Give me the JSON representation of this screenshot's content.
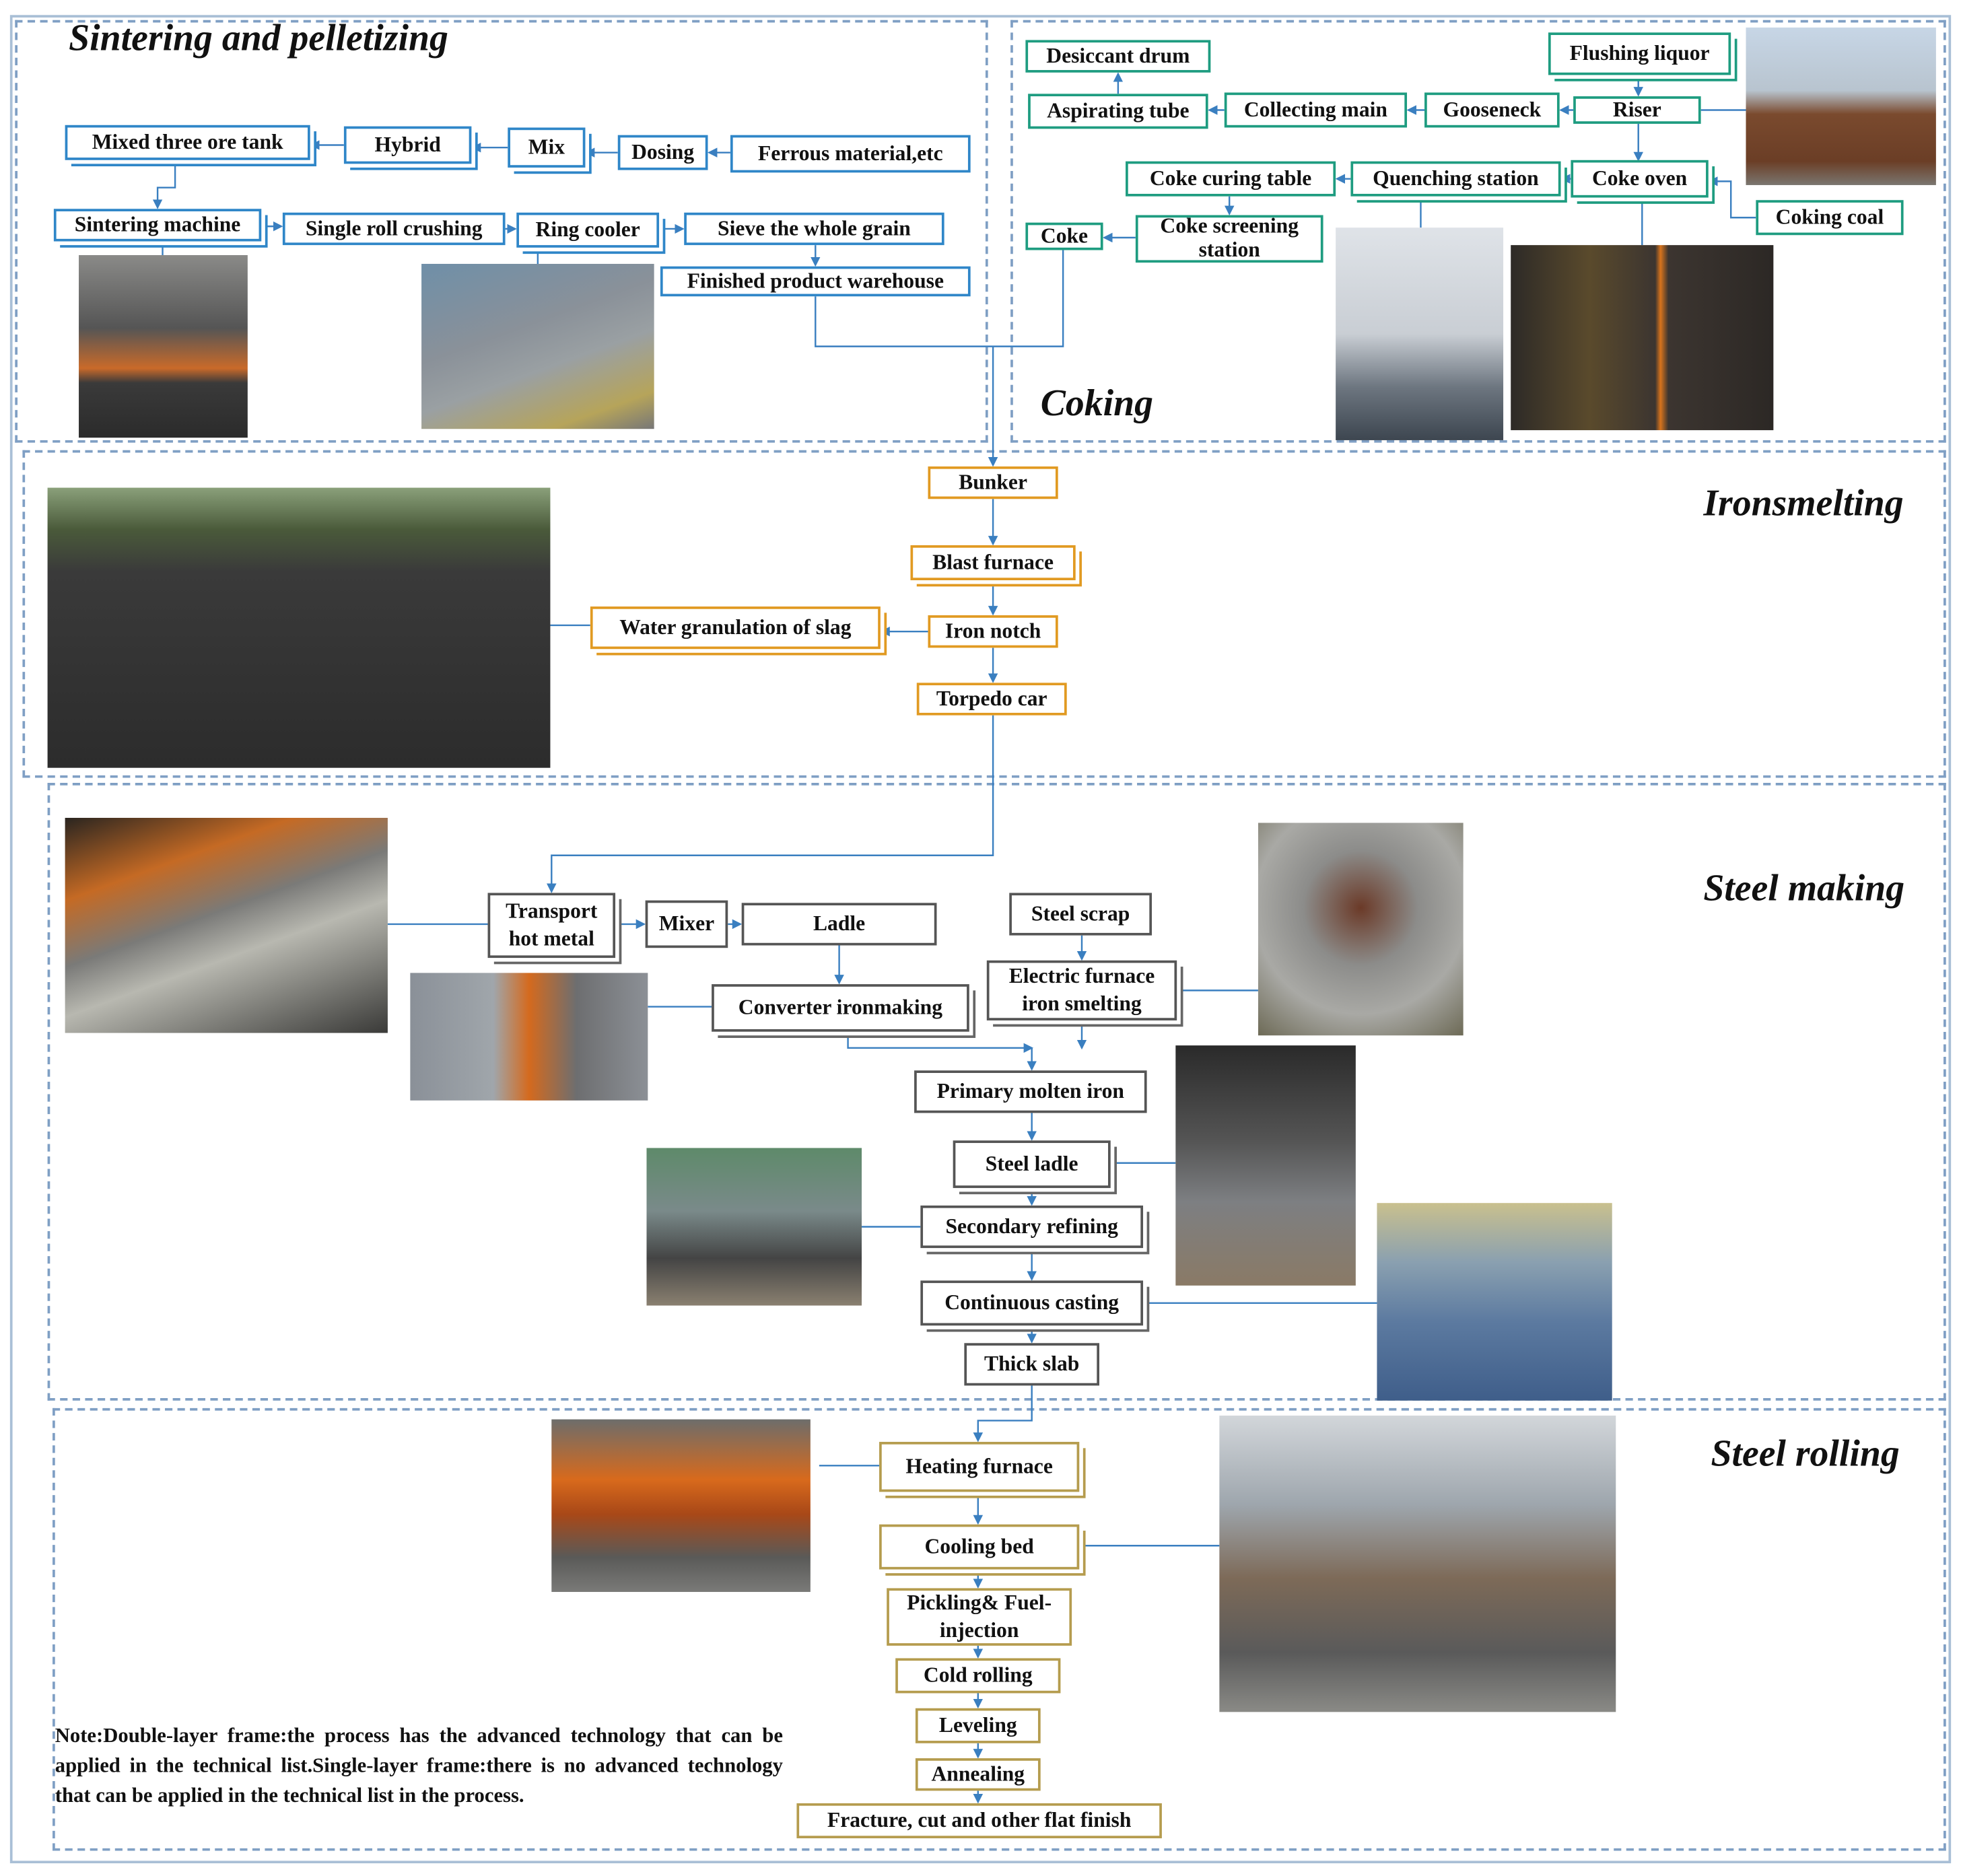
{
  "sections": {
    "sintering": "Sintering and pelletizing",
    "coking": "Coking",
    "ironsmelting": "Ironsmelting",
    "steelmaking": "Steel making",
    "steelrolling": "Steel rolling"
  },
  "nodes": {
    "mixed_tank": "Mixed three ore tank",
    "hybrid": "Hybrid",
    "mix": "Mix",
    "dosing": "Dosing",
    "ferrous": "Ferrous material,etc",
    "sintering_machine": "Sintering machine",
    "single_roll": "Single roll crushing",
    "ring_cooler": "Ring cooler",
    "sieve": "Sieve the whole grain",
    "finished": "Finished product warehouse",
    "desiccant": "Desiccant drum",
    "aspirating": "Aspirating tube",
    "collecting": "Collecting main",
    "gooseneck": "Gooseneck",
    "riser": "Riser",
    "flushing": "Flushing liquor",
    "coke_oven": "Coke oven",
    "quenching": "Quenching station",
    "curing": "Coke curing table",
    "screening": "Coke screening station",
    "coke": "Coke",
    "coking_coal": "Coking coal",
    "bunker": "Bunker",
    "blast_furnace": "Blast furnace",
    "iron_notch": "Iron notch",
    "torpedo": "Torpedo car",
    "water_gran": "Water granulation of slag",
    "transport": "Transport hot metal",
    "mixer": "Mixer",
    "ladle": "Ladle",
    "steel_scrap": "Steel scrap",
    "electric_furnace": "Electric furnace iron smelting",
    "converter": "Converter ironmaking",
    "primary": "Primary molten iron",
    "steel_ladle": "Steel ladle",
    "secondary": "Secondary refining",
    "continuous": "Continuous casting",
    "thick_slab": "Thick slab",
    "heating": "Heating furnace",
    "cooling_bed": "Cooling bed",
    "pickling": "Pickling& Fuel-injection",
    "cold_rolling": "Cold rolling",
    "leveling": "Leveling",
    "annealing": "Annealing",
    "fracture": "Fracture, cut and other flat finish"
  },
  "note": "Note:Double-layer frame:the process has the advanced technology that can  be applied in the technical list.Single-layer frame:there is no advanced technology that can be applied in the technical list in the process.",
  "colors": {
    "sintering": "#2f86c8",
    "coking": "#1e9c80",
    "iron": "#e19a22",
    "steel": "#555555",
    "rolling": "#b59c4e",
    "frame": "#7f9fc4"
  }
}
